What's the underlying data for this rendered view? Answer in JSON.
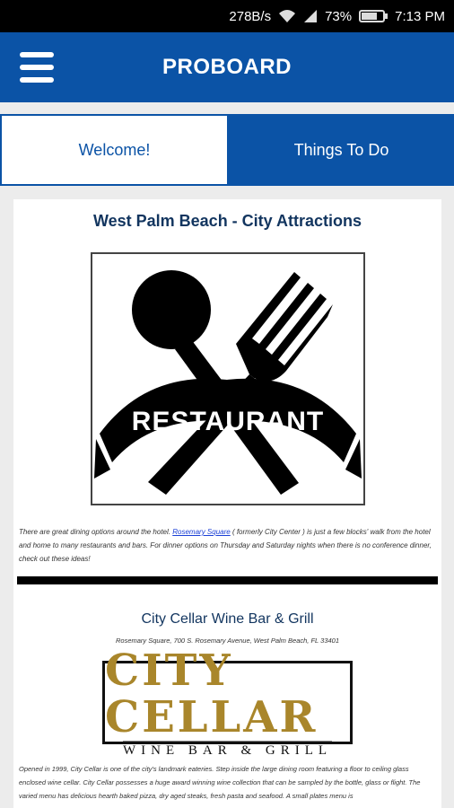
{
  "status_bar": {
    "data_rate": "278B/s",
    "battery": "73%",
    "time": "7:13 PM",
    "icons": [
      "wifi-icon",
      "signal-icon",
      "battery-icon"
    ]
  },
  "app_bar": {
    "title": "PROBOARD",
    "menu_icon": "hamburger-menu-icon"
  },
  "tabs": [
    {
      "label": "Welcome!",
      "active": true
    },
    {
      "label": "Things To Do",
      "active": false
    }
  ],
  "content": {
    "title": "West Palm Beach - City Attractions",
    "restaurant_logo_text": "RESTAURANT",
    "intro_before_link": "There are great dining options around the hotel. ",
    "intro_link": "Rosemary Square",
    "intro_after_link": " ( formerly City Center ) is just a few blocks' walk from the hotel and home to many restaurants and bars. For dinner options on Thursday and Saturday nights when there is no conference dinner, check out these ideas!",
    "venue": {
      "name": "City Cellar Wine Bar & Grill",
      "address": "Rosemary Square, 700 S. Rosemary Avenue, West Palm Beach, FL 33401",
      "logo_main": "CITY CELLAR",
      "logo_sub": "WINE BAR & GRILL",
      "description": "Opened in 1999, City Cellar is one of the city's landmark eateries. Step inside the large dining room featuring a floor to ceiling glass enclosed wine cellar. City Cellar possesses a huge award winning wine collection that can be sampled by the bottle, glass or flight. The varied menu has delicious hearth baked pizza, dry aged steaks, fresh pasta and seafood. A small plates menu is"
    }
  },
  "colors": {
    "primary": "#0b53a6",
    "title_text": "#12355f",
    "link": "#1a3fd6",
    "gold": "#a9862b"
  }
}
